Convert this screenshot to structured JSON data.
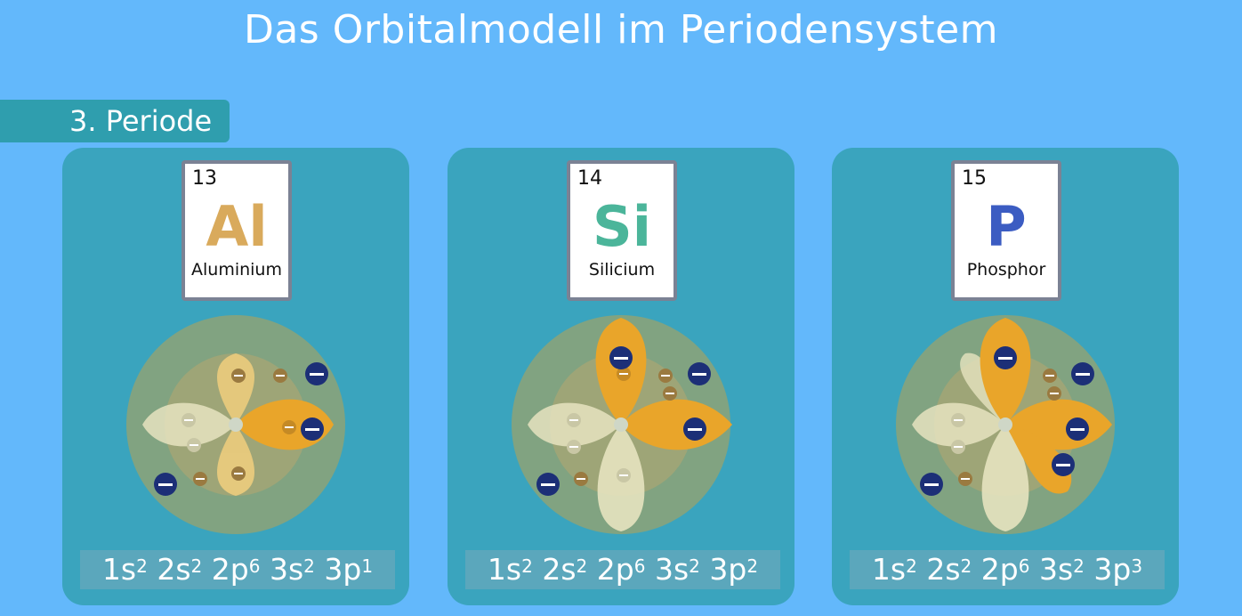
{
  "title": "Das Orbitalmodell im Periodensystem",
  "period_label": "3. Periode",
  "elements": [
    {
      "number": "13",
      "symbol": "Al",
      "name": "Aluminium",
      "symbol_color": "#d9aa5c",
      "config": [
        {
          "base": "1s",
          "exp": "2"
        },
        {
          "base": "2s",
          "exp": "2"
        },
        {
          "base": "2p",
          "exp": "6"
        },
        {
          "base": "3s",
          "exp": "2"
        },
        {
          "base": "3p",
          "exp": "1"
        }
      ]
    },
    {
      "number": "14",
      "symbol": "Si",
      "name": "Silicium",
      "symbol_color": "#4bb59a",
      "config": [
        {
          "base": "1s",
          "exp": "2"
        },
        {
          "base": "2s",
          "exp": "2"
        },
        {
          "base": "2p",
          "exp": "6"
        },
        {
          "base": "3s",
          "exp": "2"
        },
        {
          "base": "3p",
          "exp": "2"
        }
      ]
    },
    {
      "number": "15",
      "symbol": "P",
      "name": "Phosphor",
      "symbol_color": "#3b5cc2",
      "config": [
        {
          "base": "1s",
          "exp": "2"
        },
        {
          "base": "2s",
          "exp": "2"
        },
        {
          "base": "2p",
          "exp": "6"
        },
        {
          "base": "3s",
          "exp": "2"
        },
        {
          "base": "3p",
          "exp": "3"
        }
      ]
    }
  ]
}
